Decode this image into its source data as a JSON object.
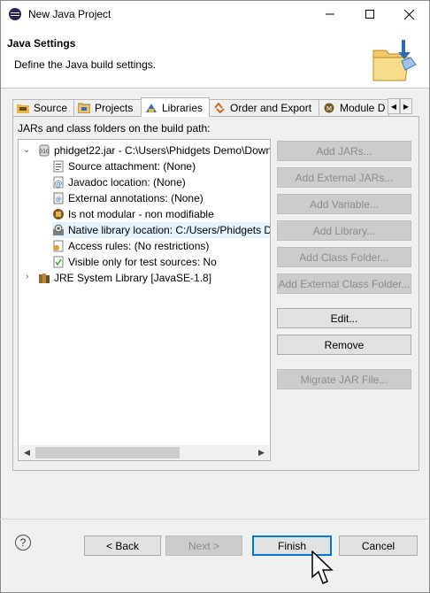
{
  "window": {
    "title": "New Java Project"
  },
  "header": {
    "title": "Java Settings",
    "description": "Define the Java build settings."
  },
  "tabs": [
    {
      "label": "Source"
    },
    {
      "label": "Projects"
    },
    {
      "label": "Libraries"
    },
    {
      "label": "Order and Export"
    },
    {
      "label": "Module D"
    }
  ],
  "panel": {
    "label": "JARs and class folders on the build path:"
  },
  "tree": [
    {
      "label": "phidget22.jar - C:\\Users\\Phidgets Demo\\Down",
      "icon": "jar-icon"
    },
    {
      "label": "Source attachment: (None)",
      "icon": "source-attachment-icon"
    },
    {
      "label": "Javadoc location: (None)",
      "icon": "javadoc-icon"
    },
    {
      "label": "External annotations: (None)",
      "icon": "annotations-icon"
    },
    {
      "label": "Is not modular - non modifiable",
      "icon": "module-icon"
    },
    {
      "label": "Native library location: C:/Users/Phidgets D",
      "icon": "native-library-icon"
    },
    {
      "label": "Access rules: (No restrictions)",
      "icon": "access-rules-icon"
    },
    {
      "label": "Visible only for test sources: No",
      "icon": "test-sources-icon"
    },
    {
      "label": "JRE System Library [JavaSE-1.8]",
      "icon": "library-icon"
    }
  ],
  "side_buttons": {
    "add_jars": "Add JARs...",
    "add_external_jars": "Add External JARs...",
    "add_variable": "Add Variable...",
    "add_library": "Add Library...",
    "add_class_folder": "Add Class Folder...",
    "add_external_class_folder": "Add External Class Folder...",
    "edit": "Edit...",
    "remove": "Remove",
    "migrate_jar": "Migrate JAR File..."
  },
  "footer": {
    "help": "?",
    "back": "< Back",
    "next": "Next >",
    "finish": "Finish",
    "cancel": "Cancel"
  },
  "colors": {
    "selection": "#e5f3ff",
    "default_button_border": "#0078d7"
  }
}
